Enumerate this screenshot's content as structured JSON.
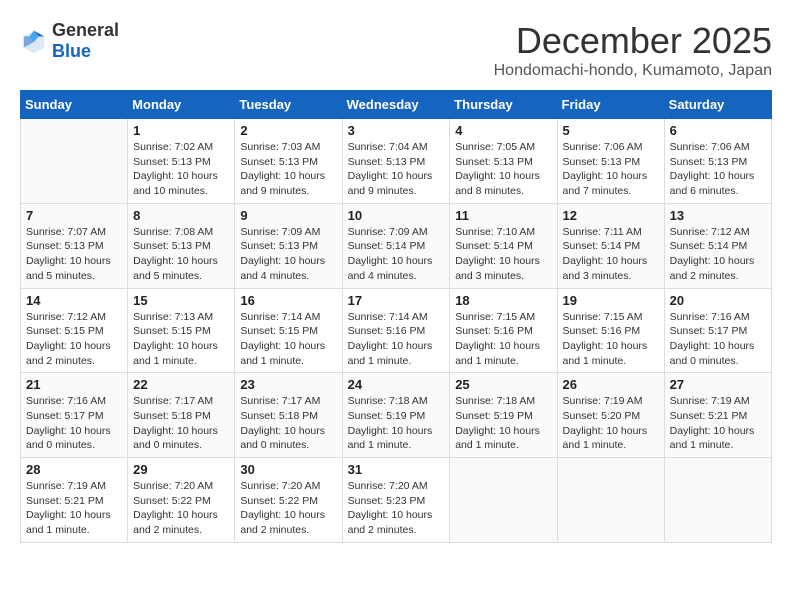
{
  "header": {
    "logo": {
      "general": "General",
      "blue": "Blue"
    },
    "month_year": "December 2025",
    "location": "Hondomachi-hondo, Kumamoto, Japan"
  },
  "days_of_week": [
    "Sunday",
    "Monday",
    "Tuesday",
    "Wednesday",
    "Thursday",
    "Friday",
    "Saturday"
  ],
  "weeks": [
    [
      {
        "day": "",
        "info": ""
      },
      {
        "day": "1",
        "info": "Sunrise: 7:02 AM\nSunset: 5:13 PM\nDaylight: 10 hours\nand 10 minutes."
      },
      {
        "day": "2",
        "info": "Sunrise: 7:03 AM\nSunset: 5:13 PM\nDaylight: 10 hours\nand 9 minutes."
      },
      {
        "day": "3",
        "info": "Sunrise: 7:04 AM\nSunset: 5:13 PM\nDaylight: 10 hours\nand 9 minutes."
      },
      {
        "day": "4",
        "info": "Sunrise: 7:05 AM\nSunset: 5:13 PM\nDaylight: 10 hours\nand 8 minutes."
      },
      {
        "day": "5",
        "info": "Sunrise: 7:06 AM\nSunset: 5:13 PM\nDaylight: 10 hours\nand 7 minutes."
      },
      {
        "day": "6",
        "info": "Sunrise: 7:06 AM\nSunset: 5:13 PM\nDaylight: 10 hours\nand 6 minutes."
      }
    ],
    [
      {
        "day": "7",
        "info": "Sunrise: 7:07 AM\nSunset: 5:13 PM\nDaylight: 10 hours\nand 5 minutes."
      },
      {
        "day": "8",
        "info": "Sunrise: 7:08 AM\nSunset: 5:13 PM\nDaylight: 10 hours\nand 5 minutes."
      },
      {
        "day": "9",
        "info": "Sunrise: 7:09 AM\nSunset: 5:13 PM\nDaylight: 10 hours\nand 4 minutes."
      },
      {
        "day": "10",
        "info": "Sunrise: 7:09 AM\nSunset: 5:14 PM\nDaylight: 10 hours\nand 4 minutes."
      },
      {
        "day": "11",
        "info": "Sunrise: 7:10 AM\nSunset: 5:14 PM\nDaylight: 10 hours\nand 3 minutes."
      },
      {
        "day": "12",
        "info": "Sunrise: 7:11 AM\nSunset: 5:14 PM\nDaylight: 10 hours\nand 3 minutes."
      },
      {
        "day": "13",
        "info": "Sunrise: 7:12 AM\nSunset: 5:14 PM\nDaylight: 10 hours\nand 2 minutes."
      }
    ],
    [
      {
        "day": "14",
        "info": "Sunrise: 7:12 AM\nSunset: 5:15 PM\nDaylight: 10 hours\nand 2 minutes."
      },
      {
        "day": "15",
        "info": "Sunrise: 7:13 AM\nSunset: 5:15 PM\nDaylight: 10 hours\nand 1 minute."
      },
      {
        "day": "16",
        "info": "Sunrise: 7:14 AM\nSunset: 5:15 PM\nDaylight: 10 hours\nand 1 minute."
      },
      {
        "day": "17",
        "info": "Sunrise: 7:14 AM\nSunset: 5:16 PM\nDaylight: 10 hours\nand 1 minute."
      },
      {
        "day": "18",
        "info": "Sunrise: 7:15 AM\nSunset: 5:16 PM\nDaylight: 10 hours\nand 1 minute."
      },
      {
        "day": "19",
        "info": "Sunrise: 7:15 AM\nSunset: 5:16 PM\nDaylight: 10 hours\nand 1 minute."
      },
      {
        "day": "20",
        "info": "Sunrise: 7:16 AM\nSunset: 5:17 PM\nDaylight: 10 hours\nand 0 minutes."
      }
    ],
    [
      {
        "day": "21",
        "info": "Sunrise: 7:16 AM\nSunset: 5:17 PM\nDaylight: 10 hours\nand 0 minutes."
      },
      {
        "day": "22",
        "info": "Sunrise: 7:17 AM\nSunset: 5:18 PM\nDaylight: 10 hours\nand 0 minutes."
      },
      {
        "day": "23",
        "info": "Sunrise: 7:17 AM\nSunset: 5:18 PM\nDaylight: 10 hours\nand 0 minutes."
      },
      {
        "day": "24",
        "info": "Sunrise: 7:18 AM\nSunset: 5:19 PM\nDaylight: 10 hours\nand 1 minute."
      },
      {
        "day": "25",
        "info": "Sunrise: 7:18 AM\nSunset: 5:19 PM\nDaylight: 10 hours\nand 1 minute."
      },
      {
        "day": "26",
        "info": "Sunrise: 7:19 AM\nSunset: 5:20 PM\nDaylight: 10 hours\nand 1 minute."
      },
      {
        "day": "27",
        "info": "Sunrise: 7:19 AM\nSunset: 5:21 PM\nDaylight: 10 hours\nand 1 minute."
      }
    ],
    [
      {
        "day": "28",
        "info": "Sunrise: 7:19 AM\nSunset: 5:21 PM\nDaylight: 10 hours\nand 1 minute."
      },
      {
        "day": "29",
        "info": "Sunrise: 7:20 AM\nSunset: 5:22 PM\nDaylight: 10 hours\nand 2 minutes."
      },
      {
        "day": "30",
        "info": "Sunrise: 7:20 AM\nSunset: 5:22 PM\nDaylight: 10 hours\nand 2 minutes."
      },
      {
        "day": "31",
        "info": "Sunrise: 7:20 AM\nSunset: 5:23 PM\nDaylight: 10 hours\nand 2 minutes."
      },
      {
        "day": "",
        "info": ""
      },
      {
        "day": "",
        "info": ""
      },
      {
        "day": "",
        "info": ""
      }
    ]
  ]
}
